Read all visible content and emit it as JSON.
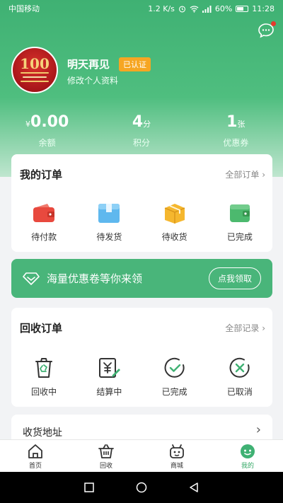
{
  "status_bar": {
    "carrier": "中国移动",
    "speed": "1.2 K/s",
    "battery": "60%",
    "time": "11:28"
  },
  "profile": {
    "avatar_text": "100",
    "name": "明天再见",
    "verified_badge": "已认证",
    "edit_link": "修改个人资料"
  },
  "stats": [
    {
      "value": "0.00",
      "prefix": "¥",
      "unit": "",
      "label": "余额"
    },
    {
      "value": "4",
      "prefix": "",
      "unit": "分",
      "label": "积分"
    },
    {
      "value": "1",
      "prefix": "",
      "unit": "张",
      "label": "优惠券"
    }
  ],
  "my_orders": {
    "title": "我的订单",
    "more": "全部订单 ›",
    "items": [
      {
        "label": "待付款",
        "icon": "wallet-icon"
      },
      {
        "label": "待发货",
        "icon": "package-icon"
      },
      {
        "label": "待收货",
        "icon": "box-icon"
      },
      {
        "label": "已完成",
        "icon": "completed-wallet-icon"
      }
    ]
  },
  "coupon_banner": {
    "text": "海量优惠卷等你来领",
    "button": "点我领取"
  },
  "recycle_orders": {
    "title": "回收订单",
    "more": "全部记录 ›",
    "items": [
      {
        "label": "回收中",
        "icon": "recycle-bin-icon"
      },
      {
        "label": "结算中",
        "icon": "settlement-icon"
      },
      {
        "label": "已完成",
        "icon": "check-circle-icon"
      },
      {
        "label": "已取消",
        "icon": "cancel-circle-icon"
      }
    ]
  },
  "address": {
    "label": "收货地址",
    "chevron": "›"
  },
  "tab_bar": [
    {
      "label": "首页",
      "icon": "home-icon"
    },
    {
      "label": "回收",
      "icon": "basket-icon"
    },
    {
      "label": "商城",
      "icon": "robot-icon"
    },
    {
      "label": "我的",
      "icon": "profile-icon"
    }
  ],
  "colors": {
    "brand_green": "#3fb173",
    "badge_orange": "#f6a623",
    "active_tab": "#34a866"
  }
}
